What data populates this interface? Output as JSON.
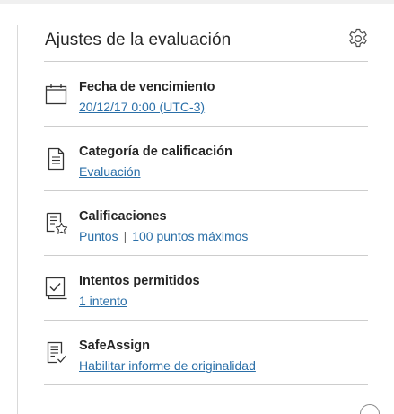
{
  "panel": {
    "title": "Ajustes de la evaluación",
    "settings_icon": "gear-icon"
  },
  "rows": [
    {
      "icon": "calendar-icon",
      "label": "Fecha de vencimiento",
      "value": "20/12/17 0:00 (UTC-3)"
    },
    {
      "icon": "document-icon",
      "label": "Categoría de calificación",
      "value": "Evaluación"
    },
    {
      "icon": "grade-list-star-icon",
      "label": "Calificaciones",
      "value": "Puntos",
      "separator": "|",
      "value2": "100 puntos máximos"
    },
    {
      "icon": "checkbox-icon",
      "label": "Intentos permitidos",
      "value": "1 intento"
    },
    {
      "icon": "document-check-icon",
      "label": "SafeAssign",
      "value": "Habilitar informe de originalidad"
    }
  ],
  "colors": {
    "link": "#2a6fa8",
    "text": "#262626",
    "divider": "#cdcdcd"
  }
}
